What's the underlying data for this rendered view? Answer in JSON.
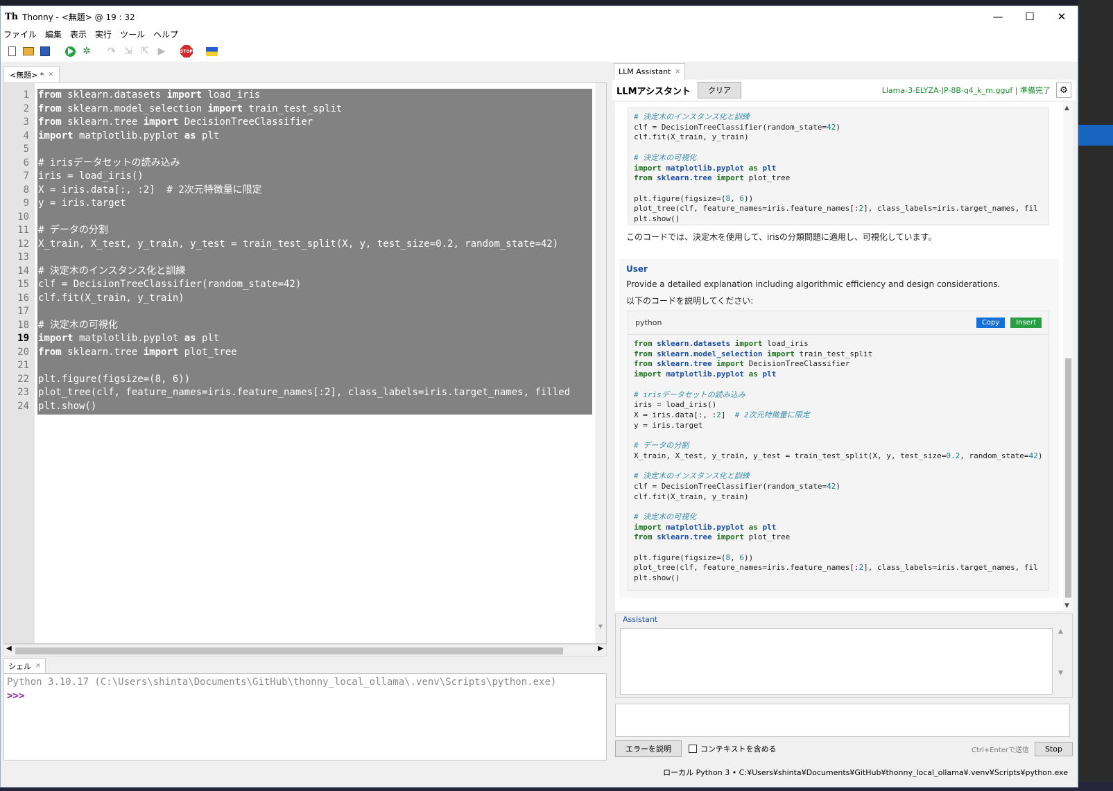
{
  "window": {
    "title": "Thonny  -  <無題>  @  19 : 32",
    "app_icon": "Th",
    "controls": {
      "minimize": "—",
      "maximize": "☐",
      "close": "✕"
    }
  },
  "menu": [
    "ファイル",
    "編集",
    "表示",
    "実行",
    "ツール",
    "ヘルプ"
  ],
  "toolbar": {
    "icons": [
      "new-file-icon",
      "open-file-icon",
      "save-icon",
      "run-icon",
      "debug-icon",
      "step-over-icon",
      "step-into-icon",
      "step-out-icon",
      "resume-icon",
      "stop-icon",
      "ukraine-flag-icon"
    ],
    "stop_label": "STOP"
  },
  "editor": {
    "tab_label": "<無題> *",
    "current_line": 19,
    "lines": [
      "1",
      "2",
      "3",
      "4",
      "5",
      "6",
      "7",
      "8",
      "9",
      "10",
      "11",
      "12",
      "13",
      "14",
      "15",
      "16",
      "17",
      "18",
      "19",
      "20",
      "21",
      "22",
      "23",
      "24"
    ],
    "code": [
      "from sklearn.datasets import load_iris",
      "from sklearn.model_selection import train_test_split",
      "from sklearn.tree import DecisionTreeClassifier",
      "import matplotlib.pyplot as plt",
      "",
      "# irisデータセットの読み込み",
      "iris = load_iris()",
      "X = iris.data[:, :2]  # 2次元特徴量に限定",
      "y = iris.target",
      "",
      "# データの分割",
      "X_train, X_test, y_train, y_test = train_test_split(X, y, test_size=0.2, random_state=42)",
      "",
      "# 決定木のインスタンス化と訓練",
      "clf = DecisionTreeClassifier(random_state=42)",
      "clf.fit(X_train, y_train)",
      "",
      "# 決定木の可視化",
      "import matplotlib.pyplot as plt",
      "from sklearn.tree import plot_tree",
      "",
      "plt.figure(figsize=(8, 6))",
      "plot_tree(clf, feature_names=iris.feature_names[:2], class_labels=iris.target_names, filled",
      "plt.show()"
    ]
  },
  "shell": {
    "tab_label": "シェル",
    "info": "Python 3.10.17 (C:\\Users\\shinta\\Documents\\GitHub\\thonny_local_ollama\\.venv\\Scripts\\python.exe)",
    "prompt": ">>>"
  },
  "llm": {
    "tab_label": "LLM Assistant",
    "title": "LLMアシスタント",
    "clear_label": "クリア",
    "model_status": "Llama-3-ELYZA-JP-8B-q4_k_m.gguf | 準備完了",
    "assistant_explanation": "このコードでは、決定木を使用して、irisの分類問題に適用し、可視化しています。",
    "user_label": "User",
    "user_line1": "Provide a detailed explanation including algorithmic efficiency and design considerations.",
    "user_line2": "以下のコードを説明してください:",
    "code_lang": "python",
    "copy_label": "Copy",
    "insert_label": "Insert",
    "assistant_label": "Assistant",
    "explain_error_label": "エラーを説明",
    "include_context_label": "コンテキストを含める",
    "send_hint": "Ctrl+Enterで送信",
    "stop_label": "Stop"
  },
  "statusbar": {
    "interpreter": "ローカル Python 3  •  C:¥Users¥shinta¥Documents¥GitHub¥thonny_local_ollama¥.venv¥Scripts¥python.exe"
  }
}
